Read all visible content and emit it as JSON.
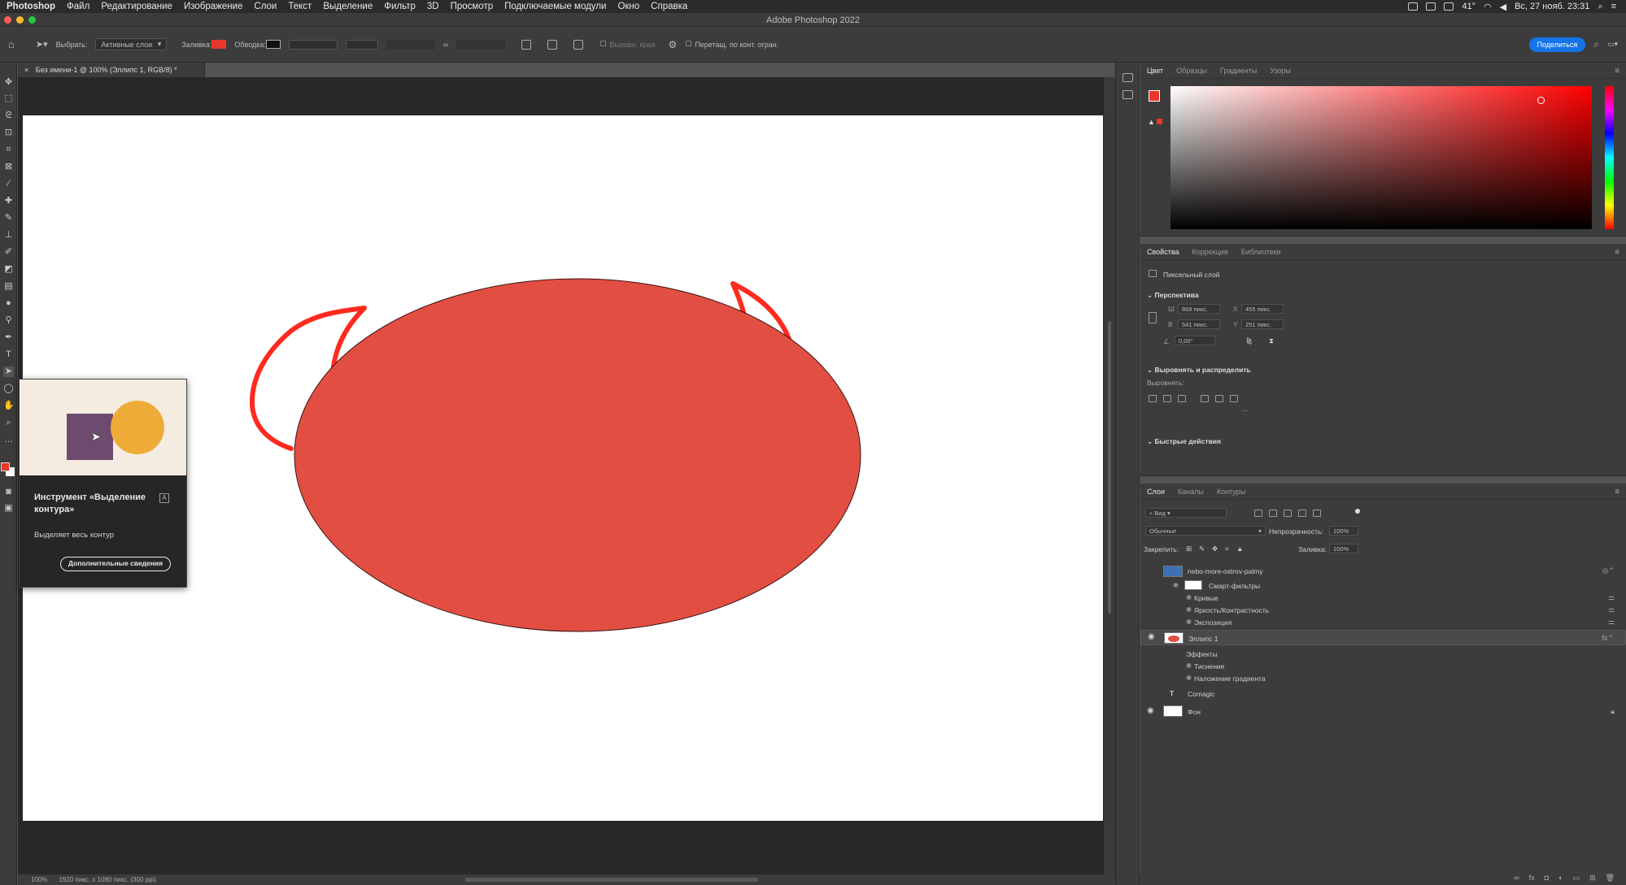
{
  "menubar": {
    "app_name": "Photoshop",
    "items": [
      "Файл",
      "Редактирование",
      "Изображение",
      "Слои",
      "Текст",
      "Выделение",
      "Фильтр",
      "3D",
      "Просмотр",
      "Подключаемые модули",
      "Окно",
      "Справка"
    ],
    "temperature": "41°",
    "clock": "Вс, 27 нояб. 23:31"
  },
  "titlebar": {
    "title": "Adobe Photoshop 2022"
  },
  "options": {
    "select_label": "Выбрать:",
    "select_value": "Активные слои",
    "fill_label": "Заливка:",
    "stroke_label": "Обводка:",
    "fill_color": "#e8372b",
    "stroke_color": "#111111",
    "align_edges_label": "Выровн. края",
    "drag_label": "Перетащ. по конт. огран.",
    "share_label": "Поделиться"
  },
  "document": {
    "tab_label": "Без имени-1 @ 100% (Эллипс 1, RGB/8) *",
    "zoom": "100%",
    "doc_info": "1920 пикс. x 1080 пикс. (300 ppi)",
    "ellipse_color": "#e34e43",
    "horn_color": "#ff2a1f"
  },
  "tooltip": {
    "title": "Инструмент «Выделение контура»",
    "shortcut": "A",
    "description": "Выделяет весь контур",
    "button_label": "Дополнительные сведения"
  },
  "color_panel": {
    "tabs": [
      "Цвет",
      "Образцы",
      "Градиенты",
      "Узоры"
    ],
    "foreground": "#e8372b"
  },
  "properties_panel": {
    "tabs": [
      "Свойства",
      "Коррекция",
      "Библиотеки"
    ],
    "layer_kind": "Пиксельный слой",
    "perspective_header": "Перспектива",
    "w_label": "Ш",
    "w_value": "868 пикс.",
    "h_label": "В",
    "h_value": "541 пикс.",
    "x_label": "X",
    "x_value": "455 пикс.",
    "y_label": "Y",
    "y_value": "251 пикс.",
    "angle_value": "0,00°",
    "align_header": "Выровнять и распределить",
    "align_label": "Выровнять:",
    "quick_actions_header": "Быстрые действия"
  },
  "layers_panel": {
    "tabs": [
      "Слои",
      "Каналы",
      "Контуры"
    ],
    "filter_value": "Вид",
    "blend_mode": "Обычные",
    "opacity_label": "Непрозрачность:",
    "opacity_value": "100%",
    "lock_label": "Закрепить:",
    "fill_label": "Заливка:",
    "fill_value": "100%",
    "layers": [
      {
        "name": "nebo-more-ostrov-palmy",
        "kind": "smart"
      },
      {
        "name": "Смарт-фильтры",
        "kind": "group-label"
      },
      {
        "name": "Кривые",
        "kind": "sub"
      },
      {
        "name": "Яркость/Контрастность",
        "kind": "sub"
      },
      {
        "name": "Экспозиция",
        "kind": "sub"
      },
      {
        "name": "Эллипс 1",
        "kind": "shape",
        "selected": true
      },
      {
        "name": "Эффекты",
        "kind": "fx-label"
      },
      {
        "name": "Тиснение",
        "kind": "sub"
      },
      {
        "name": "Наложение градиента",
        "kind": "sub"
      },
      {
        "name": "Comagic",
        "kind": "text"
      },
      {
        "name": "Фон",
        "kind": "background"
      }
    ]
  }
}
